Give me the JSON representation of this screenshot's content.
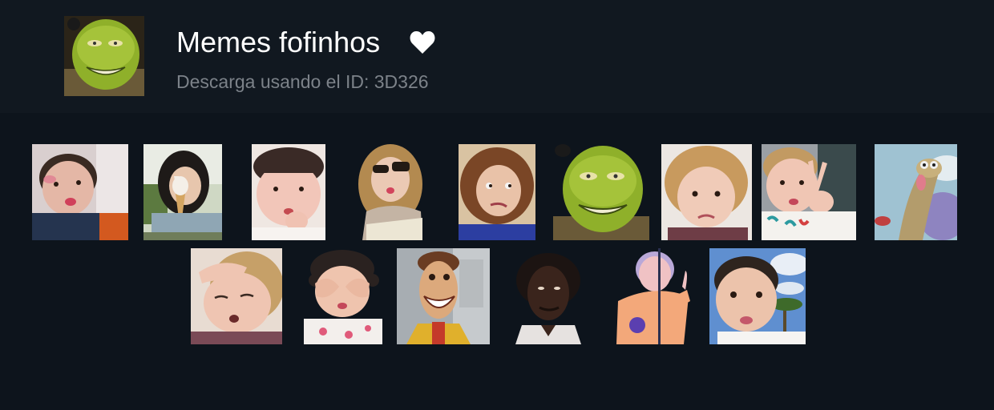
{
  "pack": {
    "title": "Memes fofinhos",
    "download_id": "Descarga usando el ID: 3D326",
    "favorite_icon": "heart-icon",
    "favorite_color": "#ffffff"
  },
  "colors": {
    "background": "#0d141c",
    "header_background": "#111820",
    "title": "#ffffff",
    "subtitle": "#7c8289"
  },
  "stickers": [
    {
      "name": "baby-tongue-out"
    },
    {
      "name": "girl-ice-cream"
    },
    {
      "name": "toddler-pouting"
    },
    {
      "name": "girl-sunglasses"
    },
    {
      "name": "curly-girl-side-eye"
    },
    {
      "name": "shrek-smile"
    },
    {
      "name": "curly-toddler-frown"
    },
    {
      "name": "toddler-peace-sign"
    },
    {
      "name": "sid-sloth"
    },
    {
      "name": "curly-toddler-sleepy"
    },
    {
      "name": "girl-hands-on-face"
    },
    {
      "name": "woody-grin"
    },
    {
      "name": "man-dark-portrait"
    },
    {
      "name": "toddler-glowing"
    },
    {
      "name": "baby-pout-sky"
    }
  ]
}
